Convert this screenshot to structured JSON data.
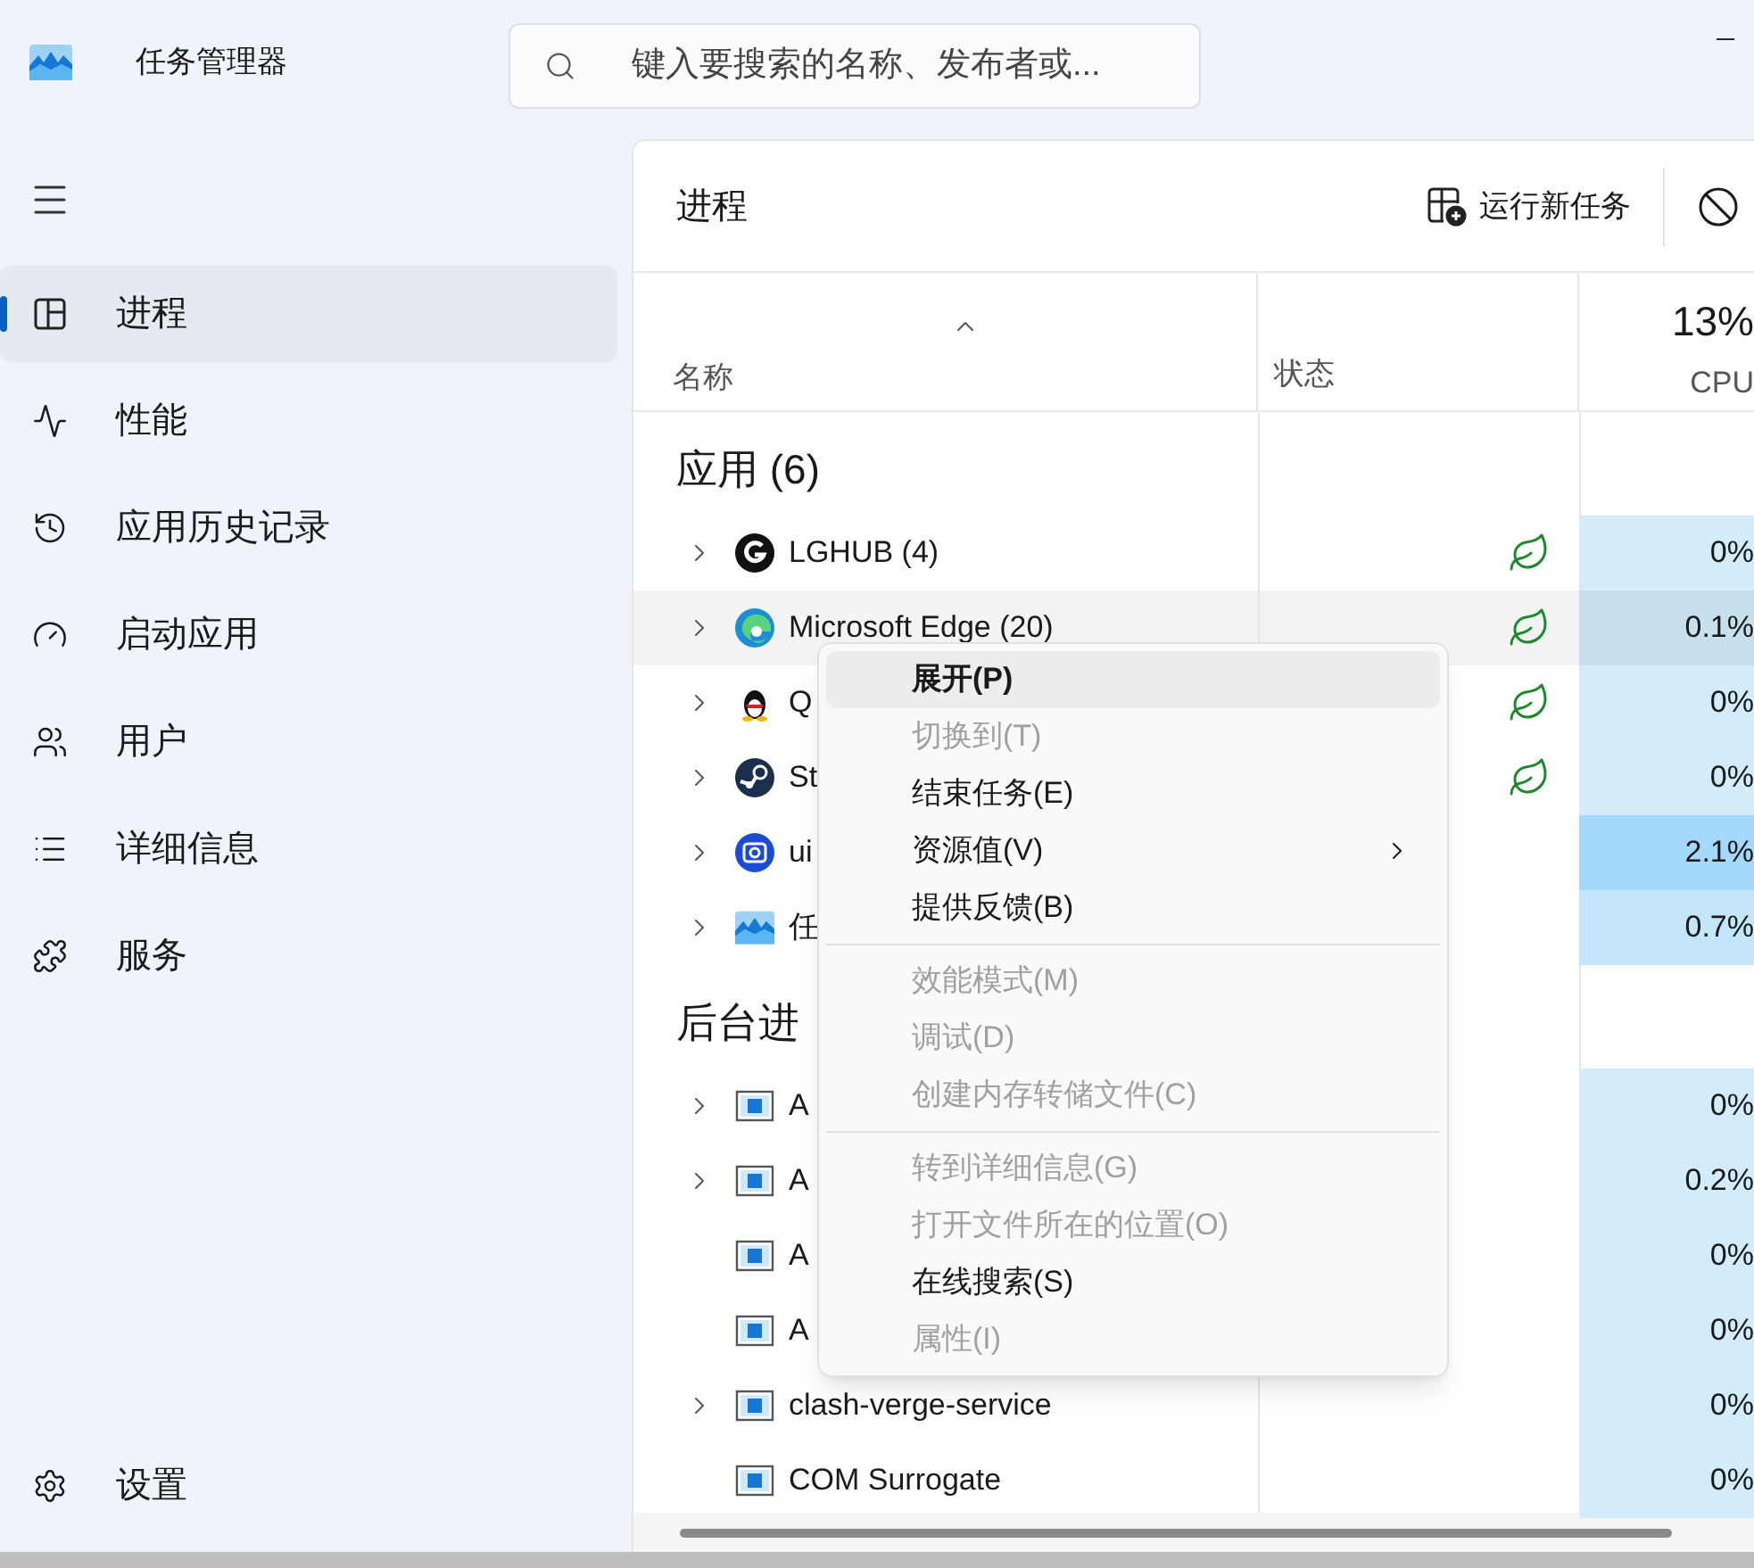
{
  "window": {
    "title": "任务管理器"
  },
  "search": {
    "placeholder": "键入要搜索的名称、发布者或..."
  },
  "sidebar": {
    "items": [
      {
        "kind": "processes",
        "label": "进程",
        "selected": true
      },
      {
        "kind": "performance",
        "label": "性能",
        "selected": false
      },
      {
        "kind": "history",
        "label": "应用历史记录",
        "selected": false
      },
      {
        "kind": "startup",
        "label": "启动应用",
        "selected": false
      },
      {
        "kind": "users",
        "label": "用户",
        "selected": false
      },
      {
        "kind": "details",
        "label": "详细信息",
        "selected": false
      },
      {
        "kind": "services",
        "label": "服务",
        "selected": false
      }
    ],
    "settings": {
      "label": "设置"
    }
  },
  "page": {
    "title": "进程",
    "toolbar": [
      {
        "kind": "new-task",
        "label": "运行新任务"
      },
      {
        "kind": "end-task"
      }
    ]
  },
  "table": {
    "columns": [
      {
        "label": "名称"
      },
      {
        "label": "状态"
      },
      {
        "label": "CPU",
        "total": "13%"
      }
    ],
    "groups": [
      {
        "title": "应用 (6)",
        "rows": [
          {
            "kind": "lghub",
            "name": "LGHUB (4)",
            "expandable": true,
            "eco": true,
            "hovered": false,
            "cpu": "0%",
            "color": "#d3ecfb"
          },
          {
            "kind": "edge",
            "name": "Microsoft Edge (20)",
            "expandable": true,
            "eco": true,
            "hovered": true,
            "cpu": "0.1%",
            "color": "#d3ecfb"
          },
          {
            "kind": "qq",
            "name": "Q",
            "expandable": true,
            "eco": true,
            "hovered": false,
            "cpu": "0%",
            "color": "#d3ecfb"
          },
          {
            "kind": "steam",
            "name": "St",
            "expandable": true,
            "eco": true,
            "hovered": false,
            "cpu": "0%",
            "color": "#d3ecfb"
          },
          {
            "kind": "uu",
            "name": "ui",
            "expandable": true,
            "eco": false,
            "hovered": false,
            "cpu": "2.1%",
            "color": "#a5d9fb"
          },
          {
            "kind": "taskmgr",
            "name": "任",
            "expandable": true,
            "eco": false,
            "hovered": false,
            "cpu": "0.7%",
            "color": "#c4e6fb"
          }
        ]
      },
      {
        "title": "后台进",
        "rows": [
          {
            "kind": "generic",
            "name": "A",
            "expandable": true,
            "eco": false,
            "hovered": false,
            "cpu": "0%",
            "color": "#d3ecfb"
          },
          {
            "kind": "generic",
            "name": "A",
            "expandable": true,
            "eco": false,
            "hovered": false,
            "cpu": "0.2%",
            "color": "#d3ecfb"
          },
          {
            "kind": "generic",
            "name": "A",
            "expandable": false,
            "eco": false,
            "hovered": false,
            "cpu": "0%",
            "color": "#d3ecfb"
          },
          {
            "kind": "generic",
            "name": "A",
            "expandable": false,
            "eco": false,
            "hovered": false,
            "cpu": "0%",
            "color": "#d3ecfb"
          },
          {
            "kind": "generic",
            "name": "clash-verge-service",
            "expandable": true,
            "eco": false,
            "hovered": false,
            "cpu": "0%",
            "color": "#d3ecfb"
          },
          {
            "kind": "generic",
            "name": "COM Surrogate",
            "expandable": false,
            "eco": false,
            "hovered": false,
            "cpu": "0%",
            "color": "#d3ecfb"
          }
        ]
      }
    ]
  },
  "context_menu": {
    "items": [
      {
        "kind": "item",
        "label": "展开(P)",
        "bold": true,
        "selected": true,
        "disabled": false,
        "submenu": false
      },
      {
        "kind": "item",
        "label": "切换到(T)",
        "bold": false,
        "selected": false,
        "disabled": true,
        "submenu": false
      },
      {
        "kind": "item",
        "label": "结束任务(E)",
        "bold": false,
        "selected": false,
        "disabled": false,
        "submenu": false
      },
      {
        "kind": "item",
        "label": "资源值(V)",
        "bold": false,
        "selected": false,
        "disabled": false,
        "submenu": true
      },
      {
        "kind": "item",
        "label": "提供反馈(B)",
        "bold": false,
        "selected": false,
        "disabled": false,
        "submenu": false
      },
      {
        "kind": "separator"
      },
      {
        "kind": "item",
        "label": "效能模式(M)",
        "bold": false,
        "selected": false,
        "disabled": true,
        "submenu": false
      },
      {
        "kind": "item",
        "label": "调试(D)",
        "bold": false,
        "selected": false,
        "disabled": true,
        "submenu": false
      },
      {
        "kind": "item",
        "label": "创建内存转储文件(C)",
        "bold": false,
        "selected": false,
        "disabled": true,
        "submenu": false
      },
      {
        "kind": "separator"
      },
      {
        "kind": "item",
        "label": "转到详细信息(G)",
        "bold": false,
        "selected": false,
        "disabled": true,
        "submenu": false
      },
      {
        "kind": "item",
        "label": "打开文件所在的位置(O)",
        "bold": false,
        "selected": false,
        "disabled": true,
        "submenu": false
      },
      {
        "kind": "item",
        "label": "在线搜索(S)",
        "bold": false,
        "selected": false,
        "disabled": false,
        "submenu": false
      },
      {
        "kind": "item",
        "label": "属性(I)",
        "bold": false,
        "selected": false,
        "disabled": true,
        "submenu": false
      }
    ]
  }
}
